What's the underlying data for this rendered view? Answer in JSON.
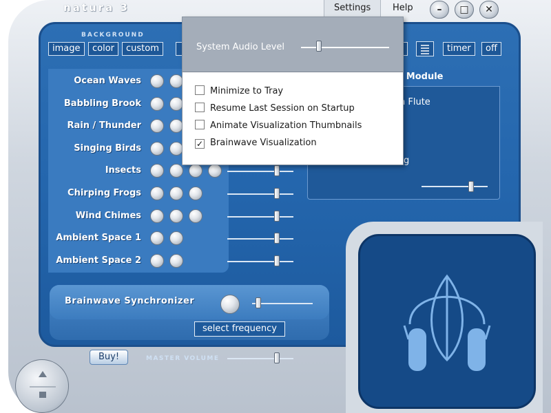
{
  "app": {
    "title": "natura 3",
    "accent_color": "#2466ad",
    "frame_color": "#cfd6df"
  },
  "menu": {
    "settings_label": "Settings",
    "help_label": "Help"
  },
  "window_buttons": {
    "minimize_glyph": "–",
    "maximize_glyph": "□",
    "close_glyph": "✕"
  },
  "background": {
    "section_label": "BACKGROUND",
    "image_label": "image",
    "color_label": "color",
    "custom_label": "custom"
  },
  "timer": {
    "timer_label": "timer",
    "off_label": "off",
    "menu_icon": "list-icon"
  },
  "sounds": [
    {
      "label": "Ocean Waves",
      "orbs": 2,
      "volume": 0.55
    },
    {
      "label": "Babbling Brook",
      "orbs": 2,
      "volume": 0.55
    },
    {
      "label": "Rain / Thunder",
      "orbs": 2,
      "volume": 0.55
    },
    {
      "label": "Singing Birds",
      "orbs": 2,
      "volume": 0.55
    },
    {
      "label": "Insects",
      "orbs": 4,
      "volume": 0.75
    },
    {
      "label": "Chirping Frogs",
      "orbs": 3,
      "volume": 0.75
    },
    {
      "label": "Wind Chimes",
      "orbs": 3,
      "volume": 0.75
    },
    {
      "label": "Ambient Space 1",
      "orbs": 2,
      "volume": 0.75
    },
    {
      "label": "Ambient Space 2",
      "orbs": 2,
      "volume": 0.75
    }
  ],
  "module": {
    "title_fragment": "n Module",
    "item_1": "n Flute",
    "item_2": "g",
    "volume": 0.75
  },
  "brainwave": {
    "label": "Brainwave Synchronizer",
    "select_label": "select frequency",
    "volume": 0.1
  },
  "footer": {
    "buy_label": "Buy!",
    "master_label": "MASTER VOLUME",
    "master_volume": 0.75
  },
  "settings_popup": {
    "audio_label": "System Audio Level",
    "audio_level": 0.2,
    "options": [
      {
        "label": "Minimize to Tray",
        "checked": false
      },
      {
        "label": "Resume Last Session on Startup",
        "checked": false
      },
      {
        "label": "Animate Visualization Thumbnails",
        "checked": false
      },
      {
        "label": "Brainwave Visualization",
        "checked": true
      }
    ]
  },
  "visualization": {
    "icon": "headphones-leaf-icon"
  }
}
